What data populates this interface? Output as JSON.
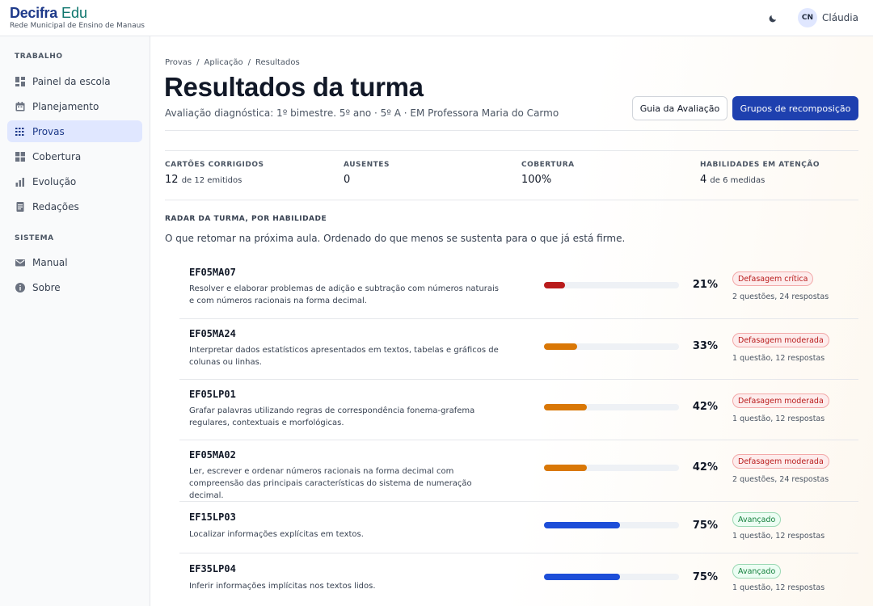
{
  "brand": {
    "name": "Decifra",
    "suffix": "Edu",
    "tagline": "Rede Municipal de Ensino de Manaus"
  },
  "header": {
    "theme_icon": "moon-icon",
    "user": {
      "initials": "CN",
      "name": "Cláudia"
    }
  },
  "sidebar": {
    "sections": [
      {
        "label": "TRABALHO",
        "items": [
          {
            "label": "Painel da escola",
            "icon": "dashboard-icon",
            "active": false
          },
          {
            "label": "Planejamento",
            "icon": "calendar-icon",
            "active": false
          },
          {
            "label": "Provas",
            "icon": "list-icon",
            "active": true
          },
          {
            "label": "Cobertura",
            "icon": "grid-icon",
            "active": false
          },
          {
            "label": "Evolução",
            "icon": "chart-icon",
            "active": false
          },
          {
            "label": "Redações",
            "icon": "document-icon",
            "active": false
          }
        ]
      },
      {
        "label": "SISTEMA",
        "items": [
          {
            "label": "Manual",
            "icon": "mail-icon",
            "active": false
          },
          {
            "label": "Sobre",
            "icon": "info-icon",
            "active": false
          }
        ]
      }
    ]
  },
  "breadcrumb": [
    "Provas",
    "Aplicação",
    "Resultados"
  ],
  "page": {
    "title": "Resultados da turma",
    "subtitle": "Avaliação diagnóstica: 1º bimestre. 5º ano · 5º A · EM Professora Maria do Carmo",
    "buttons": {
      "guide": "Guia da Avaliação",
      "groups": "Grupos de recomposição"
    }
  },
  "stats": [
    {
      "label": "CARTÕES CORRIGIDOS",
      "value": "12",
      "suffix": "de 12 emitidos"
    },
    {
      "label": "AUSENTES",
      "value": "0",
      "suffix": ""
    },
    {
      "label": "COBERTURA",
      "value": "100%",
      "suffix": ""
    },
    {
      "label": "HABILIDADES EM ATENÇÃO",
      "value": "4",
      "suffix": "de 6 medidas"
    }
  ],
  "radar": {
    "label": "RADAR DA TURMA, POR HABILIDADE",
    "description": "O que retomar na próxima aula. Ordenado do que menos se sustenta para o que já está firme.",
    "colors": {
      "critica": "#b91c1c",
      "moderada": "#d97706",
      "avancado": "#1d4ed8"
    },
    "rows": [
      {
        "code": "EF05MA07",
        "description": "Resolver e elaborar problemas de adição e subtração com números naturais e com números racionais na forma decimal.",
        "value": 21,
        "percent": "21%",
        "status": "Defasagem crítica",
        "level": "critica",
        "meta": "2 questões, 24 respostas"
      },
      {
        "code": "EF05MA24",
        "description": "Interpretar dados estatísticos apresentados em textos, tabelas e gráficos de colunas ou linhas.",
        "value": 33,
        "percent": "33%",
        "status": "Defasagem moderada",
        "level": "moderada",
        "meta": "1 questão, 12 respostas"
      },
      {
        "code": "EF05LP01",
        "description": "Grafar palavras utilizando regras de correspondência fonema-grafema regulares, contextuais e morfológicas.",
        "value": 42,
        "percent": "42%",
        "status": "Defasagem moderada",
        "level": "moderada",
        "meta": "1 questão, 12 respostas"
      },
      {
        "code": "EF05MA02",
        "description": "Ler, escrever e ordenar números racionais na forma decimal com compreensão das principais características do sistema de numeração decimal.",
        "value": 42,
        "percent": "42%",
        "status": "Defasagem moderada",
        "level": "moderada",
        "meta": "2 questões, 24 respostas"
      },
      {
        "code": "EF15LP03",
        "description": "Localizar informações explícitas em textos.",
        "value": 75,
        "percent": "75%",
        "status": "Avançado",
        "level": "avancado",
        "meta": "1 questão, 12 respostas"
      },
      {
        "code": "EF35LP04",
        "description": "Inferir informações implícitas nos textos lidos.",
        "value": 75,
        "percent": "75%",
        "status": "Avançado",
        "level": "avancado",
        "meta": "1 questão, 12 respostas"
      }
    ]
  }
}
